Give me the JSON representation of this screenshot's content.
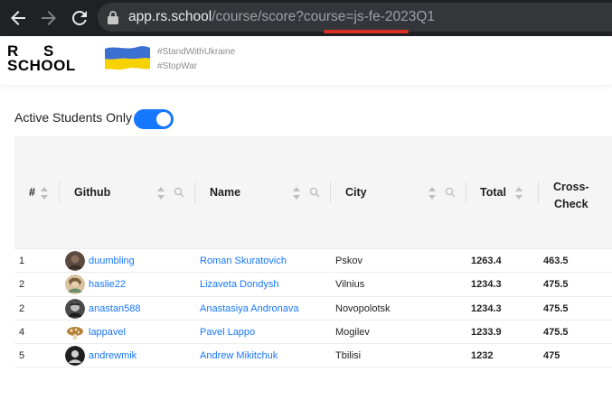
{
  "browser": {
    "url_host": "app.rs.school",
    "url_path": "/course/score?course=js-fe-2023Q1"
  },
  "header": {
    "logo_line1_left": "R",
    "logo_line1_right": "S",
    "logo_line2": "SCHOOL",
    "tag1": "#StandWithUkraine",
    "tag2": "#StopWar"
  },
  "filters": {
    "active_students_label": "Active Students Only",
    "active_students_on": true
  },
  "table": {
    "columns": {
      "num": "#",
      "github": "Github",
      "name": "Name",
      "city": "City",
      "total": "Total",
      "cross_check_1": "Cross-",
      "cross_check_2": "Check"
    },
    "rows": [
      {
        "rank": "1",
        "github": "duumbling",
        "name": "Roman Skuratovich",
        "city": "Pskov",
        "total": "1263.4",
        "cross_check": "463.5",
        "avatar_color": "#5a4a40"
      },
      {
        "rank": "2",
        "github": "haslie22",
        "name": "Lizaveta Dondysh",
        "city": "Vilnius",
        "total": "1234.3",
        "cross_check": "475.5",
        "avatar_color": "#c9a37a"
      },
      {
        "rank": "2",
        "github": "anastan588",
        "name": "Anastasiya Andronava",
        "city": "Novopolotsk",
        "total": "1234.3",
        "cross_check": "475.5",
        "avatar_color": "#6b6b6b"
      },
      {
        "rank": "4",
        "github": "lappavel",
        "name": "Pavel Lappo",
        "city": "Mogilev",
        "total": "1233.9",
        "cross_check": "475.5",
        "avatar_color": "#b5813a"
      },
      {
        "rank": "5",
        "github": "andrewmik",
        "name": "Andrew Mikitchuk",
        "city": "Tbilisi",
        "total": "1232",
        "cross_check": "475",
        "avatar_color": "#2a2a2a"
      }
    ]
  },
  "colors": {
    "accent": "#1677ff",
    "flag_blue": "#3b6fd1",
    "flag_yellow": "#f6d300",
    "url_highlight": "#d93025"
  }
}
